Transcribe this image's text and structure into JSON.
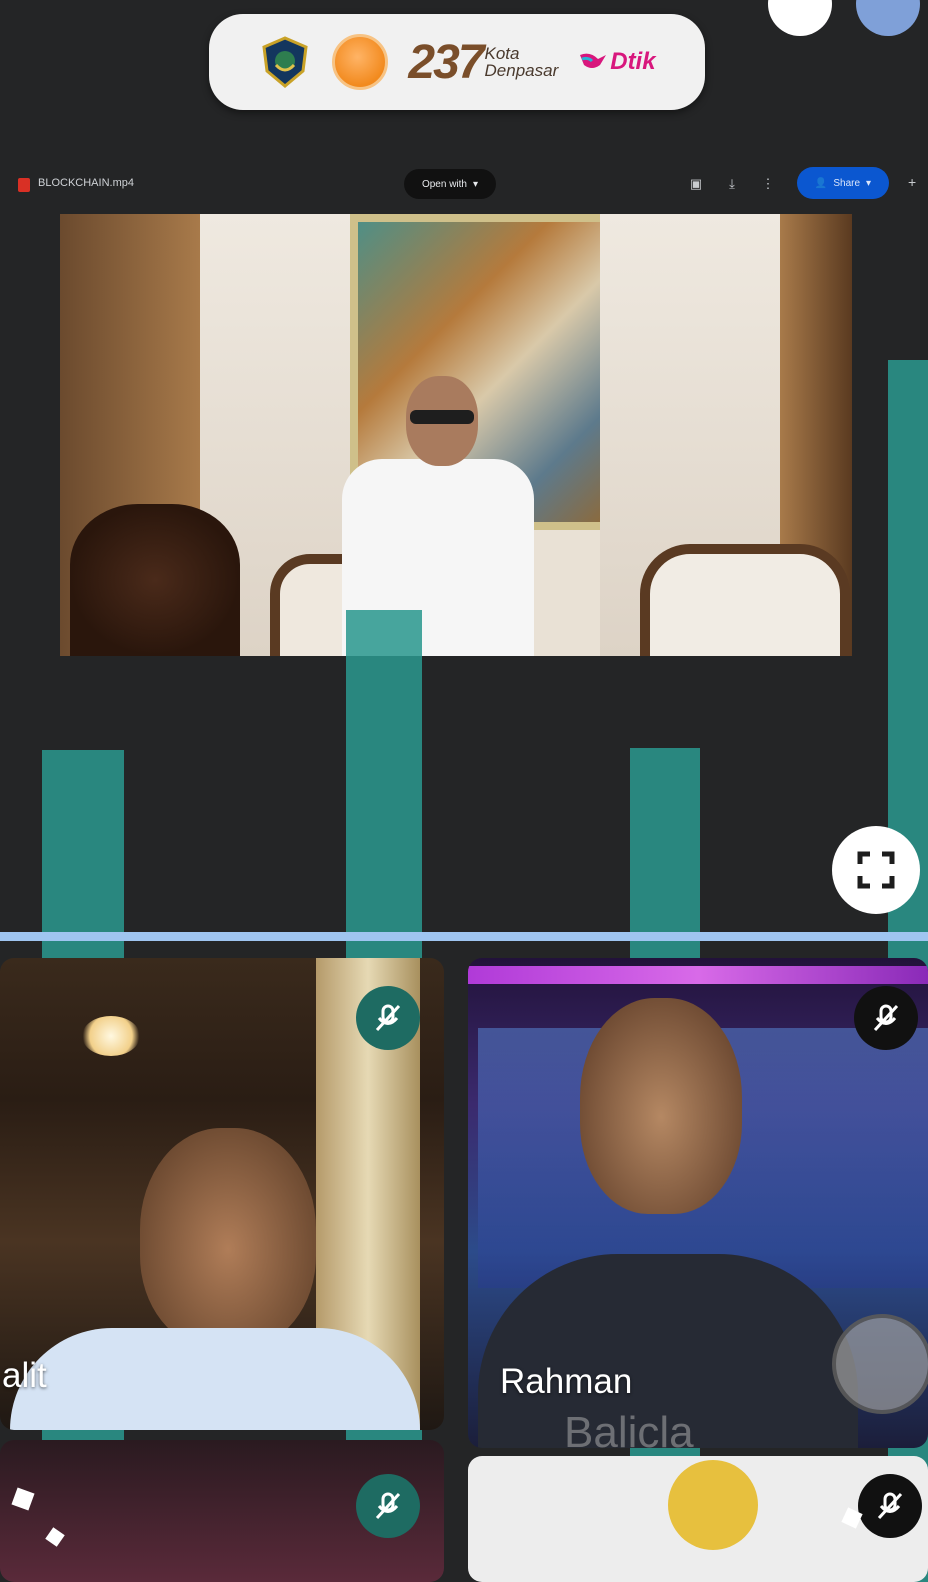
{
  "banner": {
    "number": "237",
    "kota": "Kota",
    "city": "Denpasar",
    "dtik": "Dtik"
  },
  "drive_viewer": {
    "file_name": "BLOCKCHAIN.mp4",
    "open_with": "Open with",
    "share_label": "Share"
  },
  "participants": [
    {
      "name": "alit"
    },
    {
      "name": "Rahman"
    }
  ],
  "rahman_bg_text": "Balicla",
  "icons": {
    "mic_off": "mic-off-icon",
    "fullscreen": "fullscreen-icon"
  },
  "colors": {
    "background": "#242526",
    "teal_overlay": "#2a978e",
    "divider": "#9fc5f0",
    "share_button": "#0b57d0",
    "mic_badge": "#1e6b62"
  }
}
